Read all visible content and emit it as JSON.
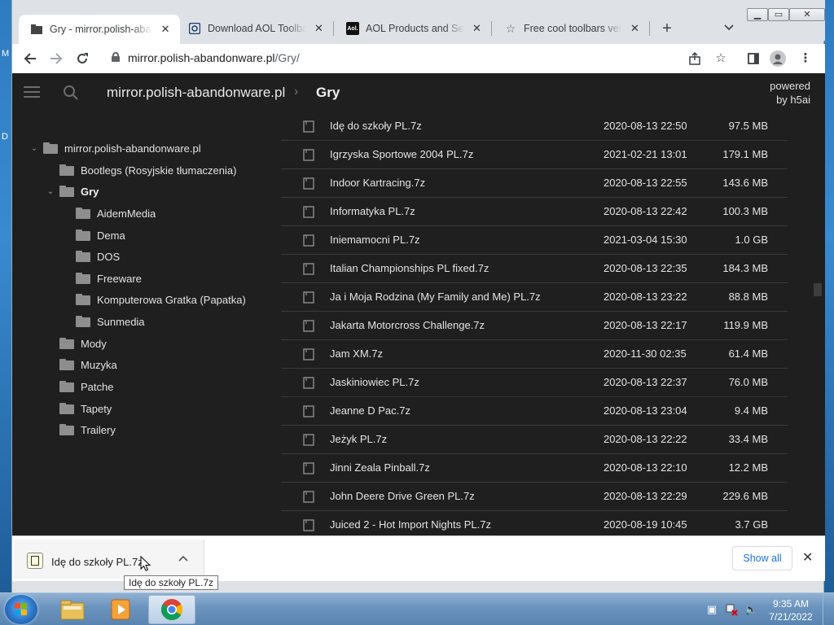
{
  "browser": {
    "tabs": [
      {
        "title": "Gry - mirror.polish-abandonware",
        "icon": "folder-icon",
        "active": true
      },
      {
        "title": "Download AOL Toolbar",
        "icon": "aol-icon",
        "active": false
      },
      {
        "title": "AOL Products and Services",
        "icon": "aol-logo-icon",
        "active": false
      },
      {
        "title": "Free cool toolbars very",
        "icon": "star-icon",
        "active": false
      }
    ],
    "url": {
      "host": "mirror.polish-abandonware.pl",
      "path": "/Gry/"
    }
  },
  "page": {
    "breadcrumb_root": "mirror.polish-abandonware.pl",
    "breadcrumb_separator": "›",
    "breadcrumb_current": "Gry",
    "powered_line1": "powered",
    "powered_line2": "by h5ai"
  },
  "tree": {
    "root": "mirror.polish-abandonware.pl",
    "items": [
      {
        "label": "Bootlegs (Rosyjskie tłumaczenia)",
        "level": 1,
        "expanded": false
      },
      {
        "label": "Gry",
        "level": 1,
        "expanded": true,
        "current": true
      },
      {
        "label": "AidemMedia",
        "level": 2
      },
      {
        "label": "Dema",
        "level": 2
      },
      {
        "label": "DOS",
        "level": 2
      },
      {
        "label": "Freeware",
        "level": 2
      },
      {
        "label": "Komputerowa Gratka (Papatka)",
        "level": 2
      },
      {
        "label": "Sunmedia",
        "level": 2
      },
      {
        "label": "Mody",
        "level": 1
      },
      {
        "label": "Muzyka",
        "level": 1
      },
      {
        "label": "Patche",
        "level": 1
      },
      {
        "label": "Tapety",
        "level": 1
      },
      {
        "label": "Trailery",
        "level": 1
      }
    ]
  },
  "files": [
    {
      "name": "Idę do szkoły PL.7z",
      "date": "2020-08-13 22:50",
      "size": "97.5 MB"
    },
    {
      "name": "Igrzyska Sportowe 2004 PL.7z",
      "date": "2021-02-21 13:01",
      "size": "179.1 MB"
    },
    {
      "name": "Indoor Kartracing.7z",
      "date": "2020-08-13 22:55",
      "size": "143.6 MB"
    },
    {
      "name": "Informatyka PL.7z",
      "date": "2020-08-13 22:42",
      "size": "100.3 MB"
    },
    {
      "name": "Iniemamocni PL.7z",
      "date": "2021-03-04 15:30",
      "size": "1.0 GB"
    },
    {
      "name": "Italian Championships PL fixed.7z",
      "date": "2020-08-13 22:35",
      "size": "184.3 MB"
    },
    {
      "name": "Ja i Moja Rodzina (My Family and Me) PL.7z",
      "date": "2020-08-13 23:22",
      "size": "88.8 MB"
    },
    {
      "name": "Jakarta Motorcross Challenge.7z",
      "date": "2020-08-13 22:17",
      "size": "119.9 MB"
    },
    {
      "name": "Jam XM.7z",
      "date": "2020-11-30 02:35",
      "size": "61.4 MB"
    },
    {
      "name": "Jaskiniowiec PL.7z",
      "date": "2020-08-13 22:37",
      "size": "76.0 MB"
    },
    {
      "name": "Jeanne D Pac.7z",
      "date": "2020-08-13 23:04",
      "size": "9.4 MB"
    },
    {
      "name": "Jeżyk PL.7z",
      "date": "2020-08-13 22:22",
      "size": "33.4 MB"
    },
    {
      "name": "Jinni Zeala Pinball.7z",
      "date": "2020-08-13 22:10",
      "size": "12.2 MB"
    },
    {
      "name": "John Deere Drive Green PL.7z",
      "date": "2020-08-13 22:29",
      "size": "229.6 MB"
    },
    {
      "name": "Juiced 2 - Hot Import Nights PL.7z",
      "date": "2020-08-19 10:45",
      "size": "3.7 GB"
    }
  ],
  "download_shelf": {
    "item_name": "Idę do szkoły PL.7z",
    "show_all": "Show all",
    "tooltip": "Idę do szkoły PL.7z"
  },
  "taskbar": {
    "time": "9:35 AM",
    "date": "7/21/2022"
  },
  "colors": {
    "page_bg": "#1f1f1f",
    "accent": "#1a73e8",
    "folder": "#8e8e8e"
  }
}
